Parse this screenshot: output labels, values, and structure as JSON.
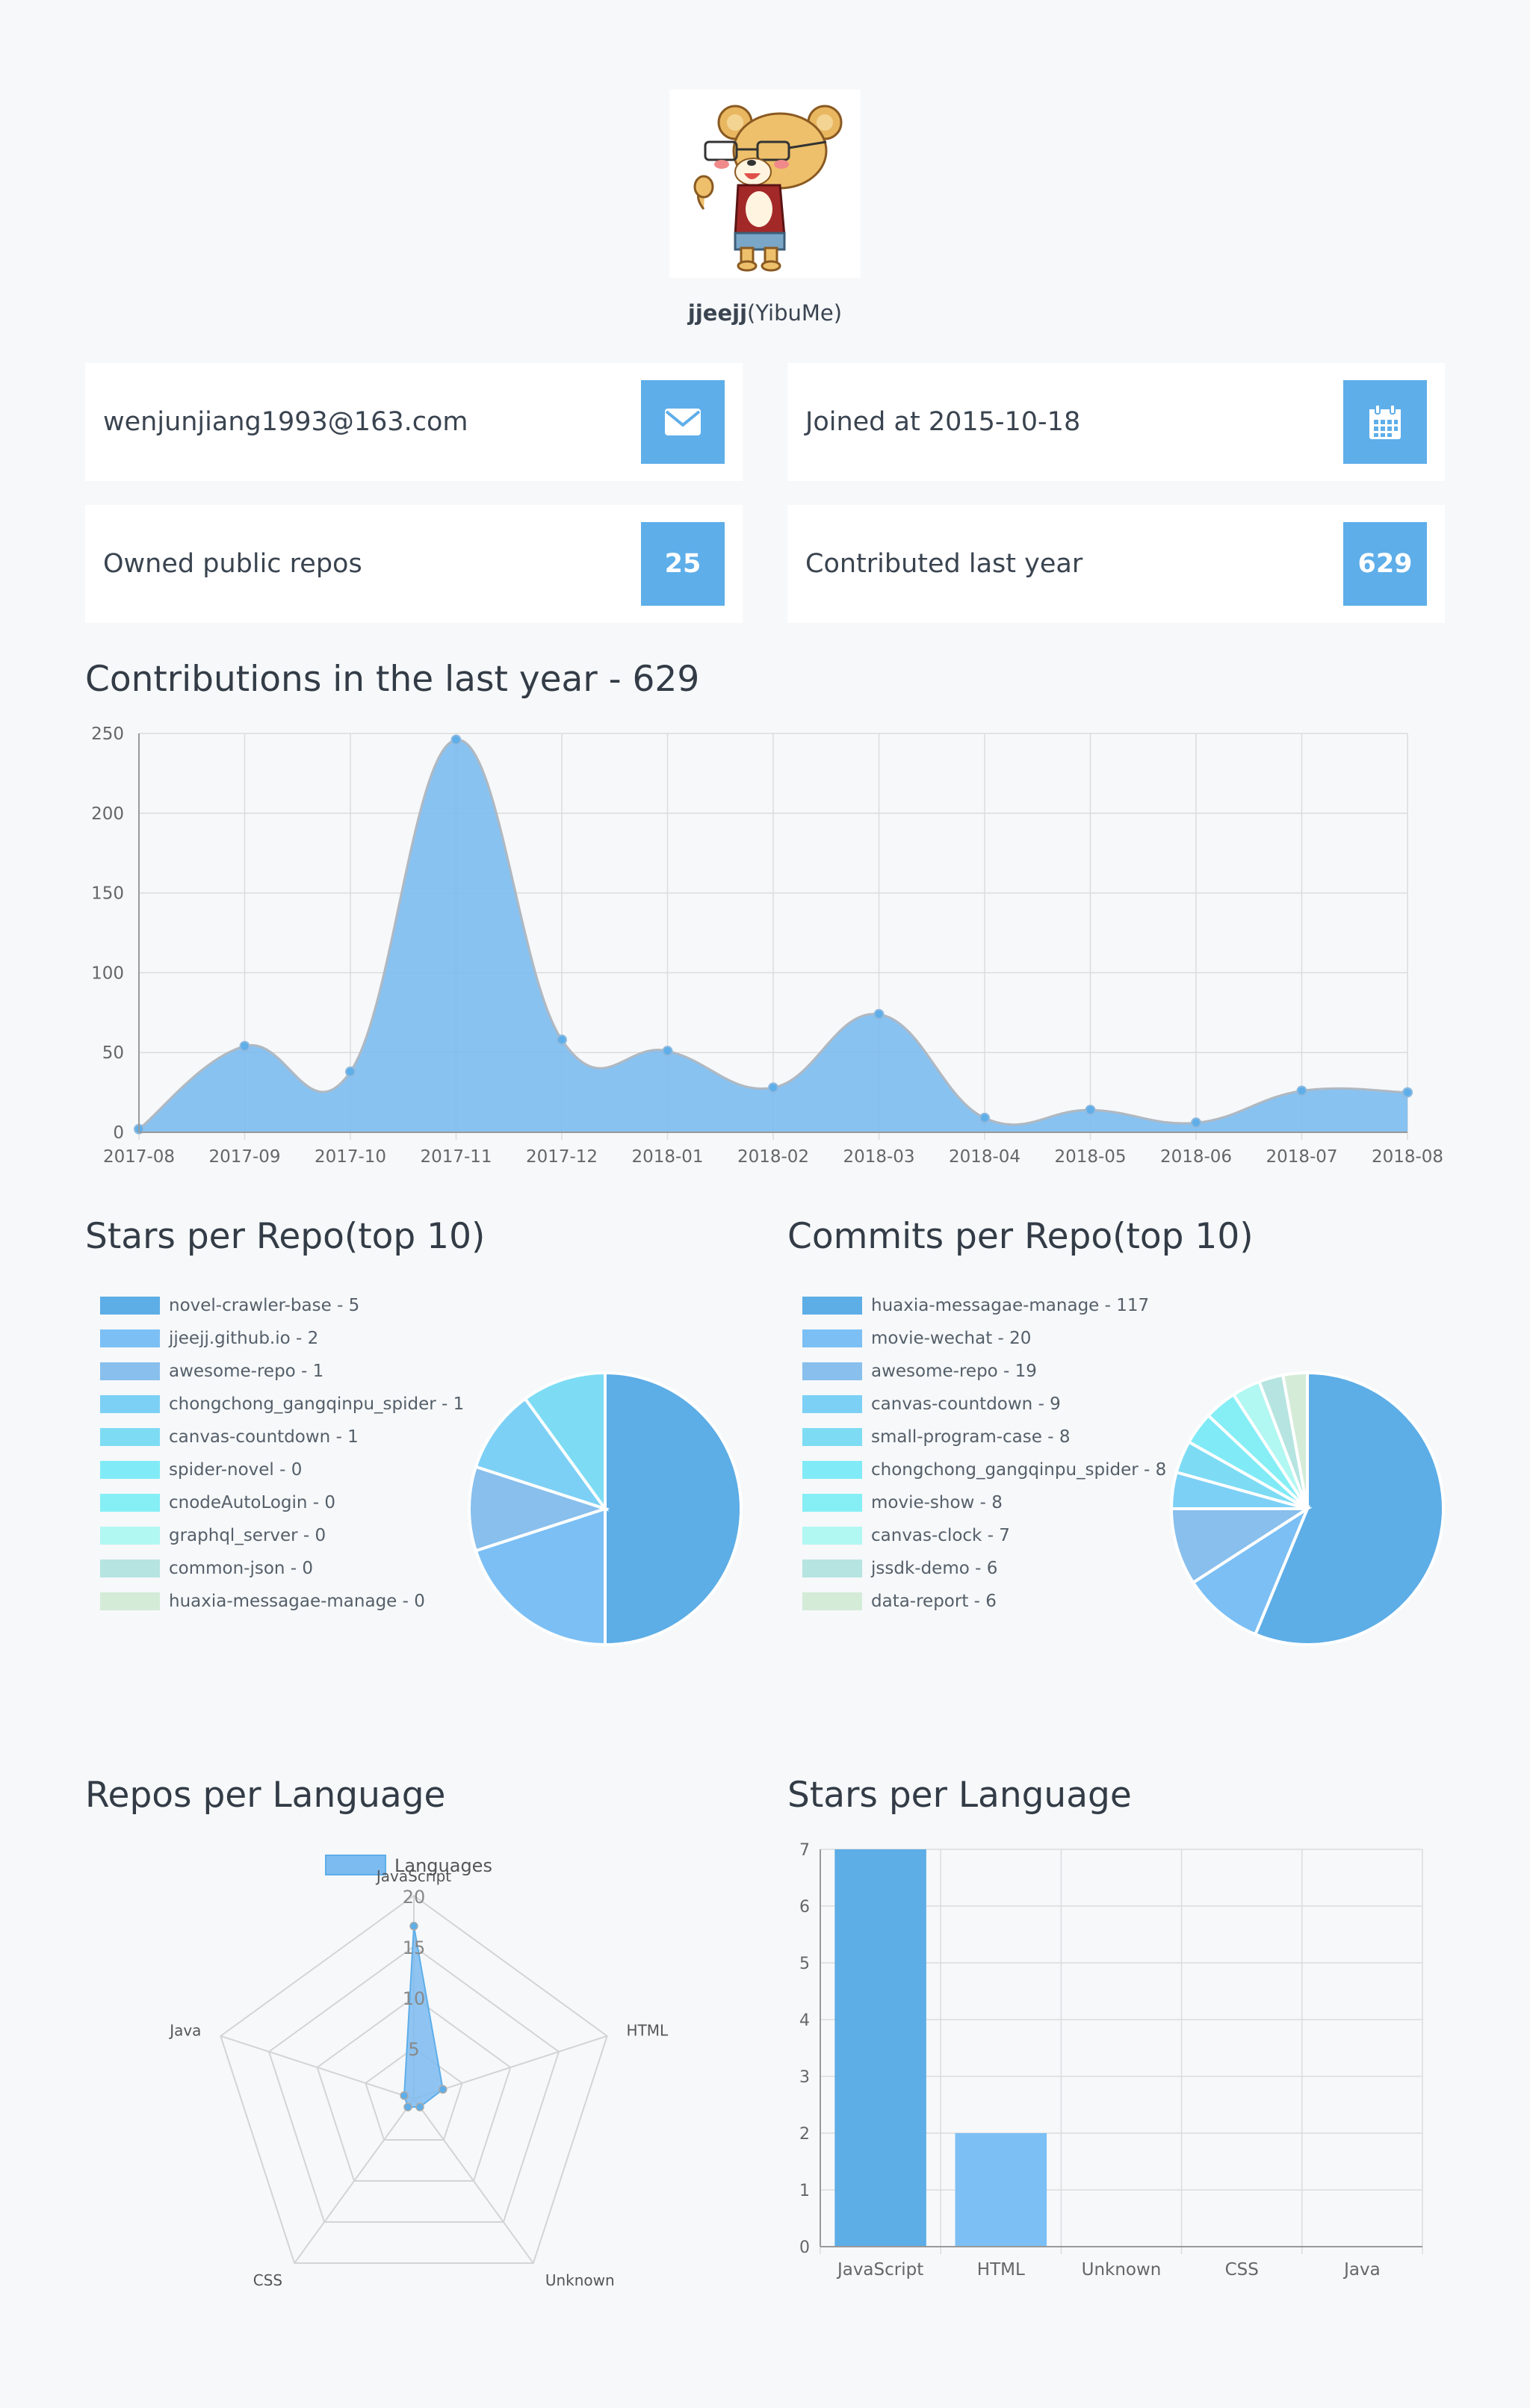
{
  "profile": {
    "login": "jjeejj",
    "name": "(YibuMe)",
    "email": "wenjunjiang1993@163.com",
    "joined": "Joined at 2015-10-18",
    "owned_label": "Owned public repos",
    "owned_count": "25",
    "contributed_label": "Contributed last year",
    "contributed_count": "629"
  },
  "icons": {
    "email": "envelope-icon",
    "joined": "calendar-icon"
  },
  "colors": {
    "accent": "#5eaee9",
    "background": "#f6f8fa"
  },
  "sections": {
    "contributions": "Contributions in the last year - 629",
    "stars_repo": "Stars per Repo(top 10)",
    "commits_repo": "Commits per Repo(top 10)",
    "repos_lang": "Repos per Language",
    "stars_lang": "Stars per Language"
  },
  "chart_data": [
    {
      "id": "contributions",
      "type": "area",
      "x": [
        "2017-08",
        "2017-09",
        "2017-10",
        "2017-11",
        "2017-12",
        "2018-01",
        "2018-02",
        "2018-03",
        "2018-04",
        "2018-05",
        "2018-06",
        "2018-07",
        "2018-08"
      ],
      "values": [
        2,
        54,
        38,
        246,
        58,
        51,
        28,
        74,
        9,
        14,
        6,
        26,
        25
      ],
      "ylim": [
        0,
        250
      ],
      "yticks": [
        0,
        50,
        100,
        150,
        200,
        250
      ],
      "grid": true,
      "color": "#7cbbf0"
    },
    {
      "id": "stars_per_repo",
      "type": "pie",
      "labels": [
        "novel-crawler-base - 5",
        "jjeejj.github.io - 2",
        "awesome-repo - 1",
        "chongchong_gangqinpu_spider - 1",
        "canvas-countdown - 1",
        "spider-novel - 0",
        "cnodeAutoLogin - 0",
        "graphql_server - 0",
        "common-json - 0",
        "huaxia-messagae-manage - 0"
      ],
      "values": [
        5,
        2,
        1,
        1,
        1,
        0,
        0,
        0,
        0,
        0
      ],
      "colors": [
        "#5dade6",
        "#7bbff4",
        "#88bfed",
        "#7dd0f5",
        "#7ddcf4",
        "#80ebf6",
        "#86eef5",
        "#b1f7f2",
        "#b6e4e0",
        "#d4ebd8"
      ],
      "legend": "left"
    },
    {
      "id": "commits_per_repo",
      "type": "pie",
      "labels": [
        "huaxia-messagae-manage - 117",
        "movie-wechat - 20",
        "awesome-repo - 19",
        "canvas-countdown - 9",
        "small-program-case - 8",
        "chongchong_gangqinpu_spider - 8",
        "movie-show - 8",
        "canvas-clock - 7",
        "jssdk-demo - 6",
        "data-report - 6"
      ],
      "values": [
        117,
        20,
        19,
        9,
        8,
        8,
        8,
        7,
        6,
        6
      ],
      "colors": [
        "#5dade6",
        "#7bbff4",
        "#88bfed",
        "#7dd0f5",
        "#7ddcf4",
        "#80ebf6",
        "#86eef5",
        "#b1f7f2",
        "#b6e4e0",
        "#d4ebd8"
      ],
      "legend": "left"
    },
    {
      "id": "repos_per_language",
      "type": "radar",
      "legend_label": "Languages",
      "axes": [
        "JavaScript",
        "HTML",
        "Unknown",
        "CSS",
        "Java"
      ],
      "values": [
        17,
        3,
        1,
        1,
        1
      ],
      "ticks": [
        5,
        10,
        15,
        20
      ],
      "rmax": 20,
      "color": "#7cbbf0"
    },
    {
      "id": "stars_per_language",
      "type": "bar",
      "categories": [
        "JavaScript",
        "HTML",
        "Unknown",
        "CSS",
        "Java"
      ],
      "values": [
        7,
        2,
        0,
        0,
        0
      ],
      "ylim": [
        0,
        7
      ],
      "yticks": [
        0,
        1,
        2,
        3,
        4,
        5,
        6,
        7
      ],
      "colors": [
        "#5dade6",
        "#7bbff4",
        "#88bfed",
        "#7dd0f5",
        "#7ddcf4"
      ]
    }
  ]
}
